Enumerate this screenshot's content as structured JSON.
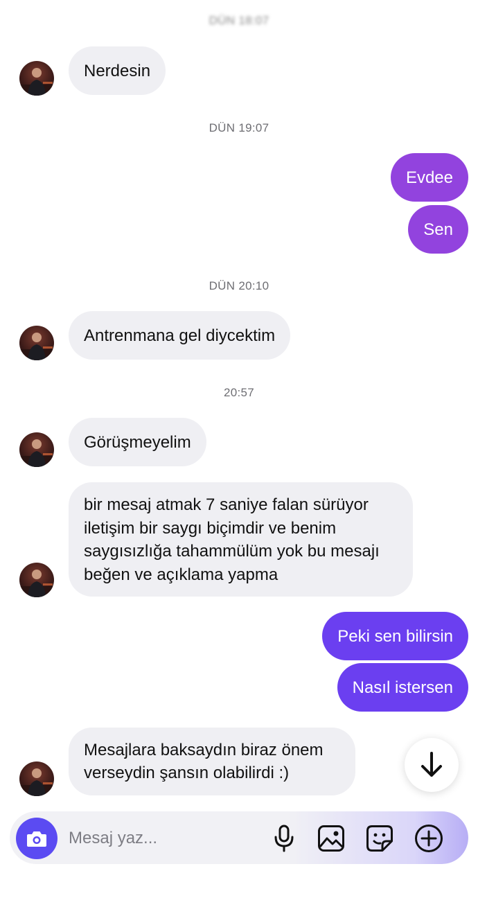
{
  "timestamps": {
    "t0": "DÜN 18:07",
    "t1": "DÜN 19:07",
    "t2": "DÜN 20:10",
    "t3": "20:57"
  },
  "messages": {
    "m1": "Nerdesin",
    "m2": "Evdee",
    "m3": "Sen",
    "m4": "Antrenmana gel diycektim",
    "m5": "Görüşmeyelim",
    "m6": [
      "bir mesaj atmak 7 saniye falan sürüyor",
      "iletişim bir saygı biçimdir ve benim",
      "saygısızlığa tahammülüm yok bu mesajı",
      "beğen ve açıklama yapma"
    ],
    "m7": "Peki sen bilirsin",
    "m8": "Nasıl istersen",
    "m9": [
      "Mesajlara baksaydın biraz önem",
      "verseydin şansın olabilirdi :)"
    ]
  },
  "composer": {
    "placeholder": "Mesaj yaz..."
  },
  "icons": {
    "scroll": "arrow-down-icon",
    "camera": "camera-icon",
    "mic": "microphone-icon",
    "gallery": "image-icon",
    "sticker": "sticker-icon",
    "plus": "plus-circle-icon"
  },
  "colors": {
    "incoming_bubble": "#efeff3",
    "outgoing_purple": "#9243de",
    "outgoing_violet": "#6b3ff0",
    "camera_button": "#5b4bf2"
  }
}
